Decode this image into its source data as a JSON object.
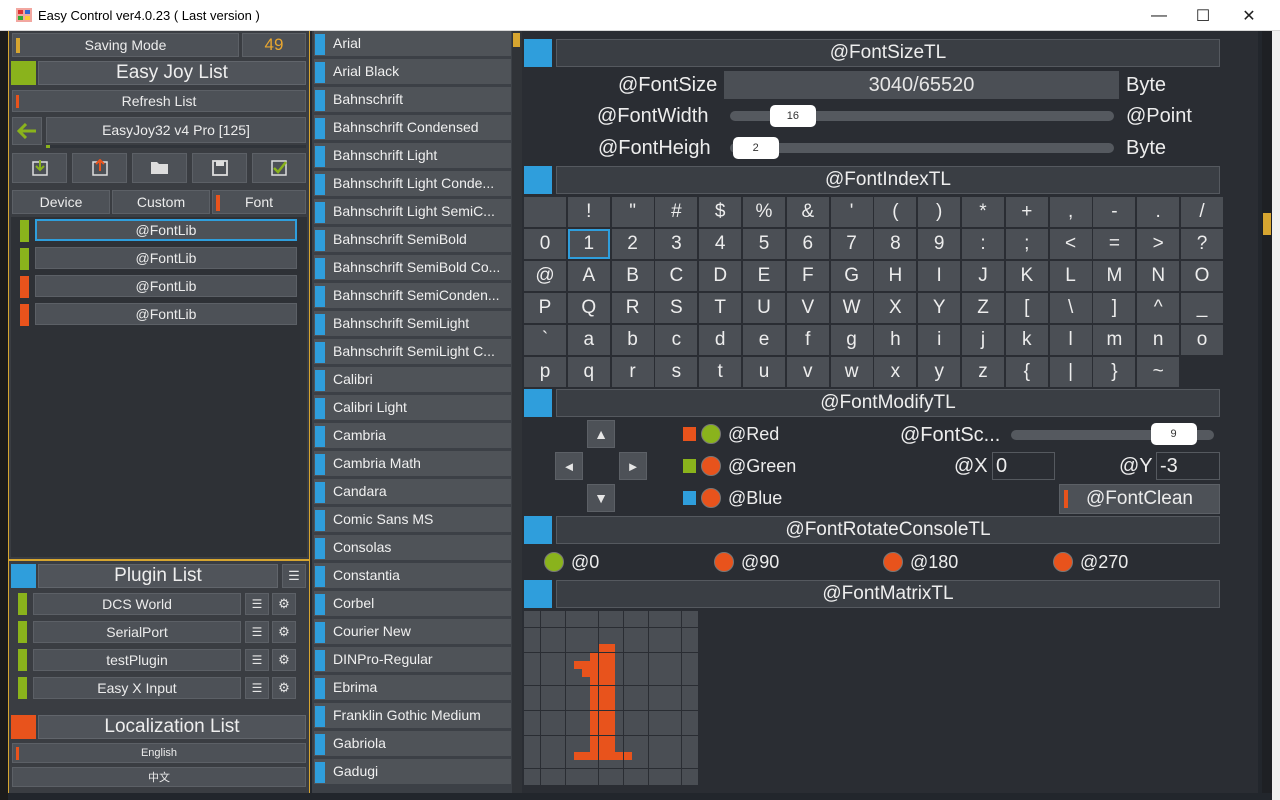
{
  "window": {
    "title": "Easy Control ver4.0.23 ( Last version )",
    "minimize": "—",
    "maximize": "☐",
    "close": "✕"
  },
  "left": {
    "saving_mode": {
      "label": "Saving Mode",
      "value": "49"
    },
    "easy_joy_title": "Easy Joy List",
    "refresh": "Refresh List",
    "device_name": "EasyJoy32 v4 Pro [125]",
    "tabs": [
      "Device",
      "Custom",
      "Font"
    ],
    "fontlibs": [
      "@FontLib",
      "@FontLib",
      "@FontLib",
      "@FontLib"
    ],
    "plugin_title": "Plugin List",
    "plugins": [
      "DCS World",
      "SerialPort",
      "testPlugin",
      "Easy X Input"
    ],
    "localization_title": "Localization List",
    "languages": [
      "English",
      "中文"
    ]
  },
  "fonts": [
    "Arial",
    "Arial Black",
    "Bahnschrift",
    "Bahnschrift Condensed",
    "Bahnschrift Light",
    "Bahnschrift Light Conde...",
    "Bahnschrift Light SemiC...",
    "Bahnschrift SemiBold",
    "Bahnschrift SemiBold Co...",
    "Bahnschrift SemiConden...",
    "Bahnschrift SemiLight",
    "Bahnschrift SemiLight C...",
    "Calibri",
    "Calibri Light",
    "Cambria",
    "Cambria Math",
    "Candara",
    "Comic Sans MS",
    "Consolas",
    "Constantia",
    "Corbel",
    "Courier New",
    "DINPro-Regular",
    "Ebrima",
    "Franklin Gothic Medium",
    "Gabriola",
    "Gadugi"
  ],
  "size_section": {
    "title": "@FontSizeTL",
    "font_size_label": "@FontSize",
    "font_size_value": "3040/65520",
    "font_size_unit": "Byte",
    "width_label": "@FontWidth",
    "width_value": 16,
    "width_unit": "@Point",
    "height_label": "@FontHeigh",
    "height_value": 2,
    "height_unit": "Byte"
  },
  "index_section": {
    "title": "@FontIndexTL",
    "selected": "1",
    "rows": [
      [
        "",
        "!",
        "\"",
        "#",
        "$",
        "%",
        "&",
        "'",
        "(",
        ")",
        "*",
        "+",
        ",",
        "-",
        ".",
        "/"
      ],
      [
        "0",
        "1",
        "2",
        "3",
        "4",
        "5",
        "6",
        "7",
        "8",
        "9",
        ":",
        ";",
        "<",
        "=",
        ">",
        "?"
      ],
      [
        "@",
        "A",
        "B",
        "C",
        "D",
        "E",
        "F",
        "G",
        "H",
        "I",
        "J",
        "K",
        "L",
        "M",
        "N",
        "O"
      ],
      [
        "P",
        "Q",
        "R",
        "S",
        "T",
        "U",
        "V",
        "W",
        "X",
        "Y",
        "Z",
        "[",
        "\\",
        "]",
        "^",
        "_"
      ],
      [
        "`",
        "a",
        "b",
        "c",
        "d",
        "e",
        "f",
        "g",
        "h",
        "i",
        "j",
        "k",
        "l",
        "m",
        "n",
        "o"
      ],
      [
        "p",
        "q",
        "r",
        "s",
        "t",
        "u",
        "v",
        "w",
        "x",
        "y",
        "z",
        "{",
        "|",
        "}",
        "~"
      ]
    ]
  },
  "modify_section": {
    "title": "@FontModifyTL",
    "red": "@Red",
    "green": "@Green",
    "blue": "@Blue",
    "scale_label": "@FontSc...",
    "scale_value": 9,
    "x_label": "@X",
    "x_value": "0",
    "y_label": "@Y",
    "y_value": "-3",
    "clean": "@FontClean"
  },
  "rotate_section": {
    "title": "@FontRotateConsoleTL",
    "options": [
      "@0",
      "@90",
      "@180",
      "@270"
    ],
    "selected": "@0"
  },
  "matrix_section": {
    "title": "@FontMatrixTL",
    "rows": 21,
    "cols": 21
  },
  "colors": {
    "accent_blue": "#2f9edc",
    "orange": "#e8531c",
    "green": "#8ab31c",
    "gold": "#d6a530"
  }
}
